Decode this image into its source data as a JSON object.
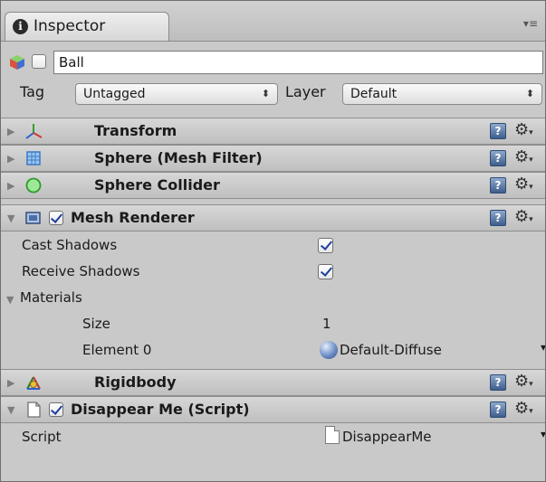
{
  "window": {
    "tab_label": "Inspector",
    "menu_glyph": "▾≡"
  },
  "object": {
    "name": "Ball",
    "tag_label": "Tag",
    "tag_value": "Untagged",
    "layer_label": "Layer",
    "layer_value": "Default"
  },
  "components": [
    {
      "name": "Transform",
      "icon": "transform-icon",
      "expanded": false,
      "has_checkbox": false
    },
    {
      "name": "Sphere (Mesh Filter)",
      "icon": "mesh-filter-icon",
      "expanded": false,
      "has_checkbox": false
    },
    {
      "name": "Sphere Collider",
      "icon": "sphere-collider-icon",
      "expanded": false,
      "has_checkbox": false
    },
    {
      "name": "Mesh Renderer",
      "icon": "mesh-renderer-icon",
      "expanded": true,
      "has_checkbox": true,
      "checked": true
    },
    {
      "name": "Rigidbody",
      "icon": "rigidbody-icon",
      "expanded": false,
      "has_checkbox": false
    },
    {
      "name": "Disappear Me (Script)",
      "icon": "script-icon",
      "expanded": true,
      "has_checkbox": true,
      "checked": true
    }
  ],
  "mesh_renderer": {
    "cast_shadows_label": "Cast Shadows",
    "cast_shadows": true,
    "receive_shadows_label": "Receive Shadows",
    "receive_shadows": true,
    "materials_label": "Materials",
    "size_label": "Size",
    "size_value": "1",
    "element0_label": "Element 0",
    "element0_value": "Default-Diffuse"
  },
  "script_component": {
    "script_label": "Script",
    "script_value": "DisappearMe"
  },
  "colors": {
    "panel_bg": "#c9c9c9",
    "checkmark": "#1f3e9e",
    "help_icon": "#3e5e8c"
  }
}
